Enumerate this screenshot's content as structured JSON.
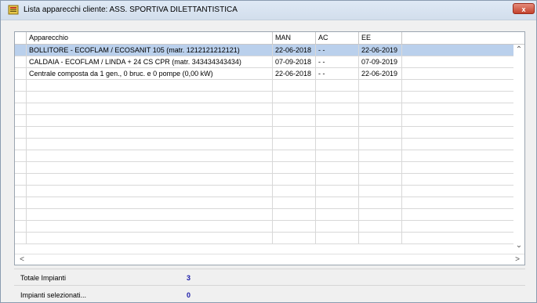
{
  "window": {
    "title": "Lista apparecchi cliente: ASS. SPORTIVA DILETTANTISTICA",
    "close_label": "x"
  },
  "table": {
    "columns": [
      "Apparecchio",
      "MAN",
      "AC",
      "EE"
    ],
    "rows": [
      {
        "apparecchio": "BOLLITORE - ECOFLAM / ECOSANIT 105  (matr. 1212121212121)",
        "man": "22-06-2018",
        "ac": "- -",
        "ee": "22-06-2019",
        "selected": true
      },
      {
        "apparecchio": "CALDAIA - ECOFLAM / LINDA + 24 CS CPR  (matr. 343434343434)",
        "man": "07-09-2018",
        "ac": "- -",
        "ee": "07-09-2019",
        "selected": false
      },
      {
        "apparecchio": "Centrale composta da 1 gen., 0 bruc. e 0 pompe (0,00 kW)",
        "man": "22-06-2018",
        "ac": "- -",
        "ee": "22-06-2019",
        "selected": false
      }
    ]
  },
  "footer": {
    "totale_label": "Totale Impianti",
    "totale_value": "3",
    "selezionati_label": "Impianti selezionati...",
    "selezionati_value": "0"
  },
  "colors": {
    "selected_row": "#bad0ec",
    "value_text": "#1a1aa8",
    "close_button": "#c4432d"
  }
}
